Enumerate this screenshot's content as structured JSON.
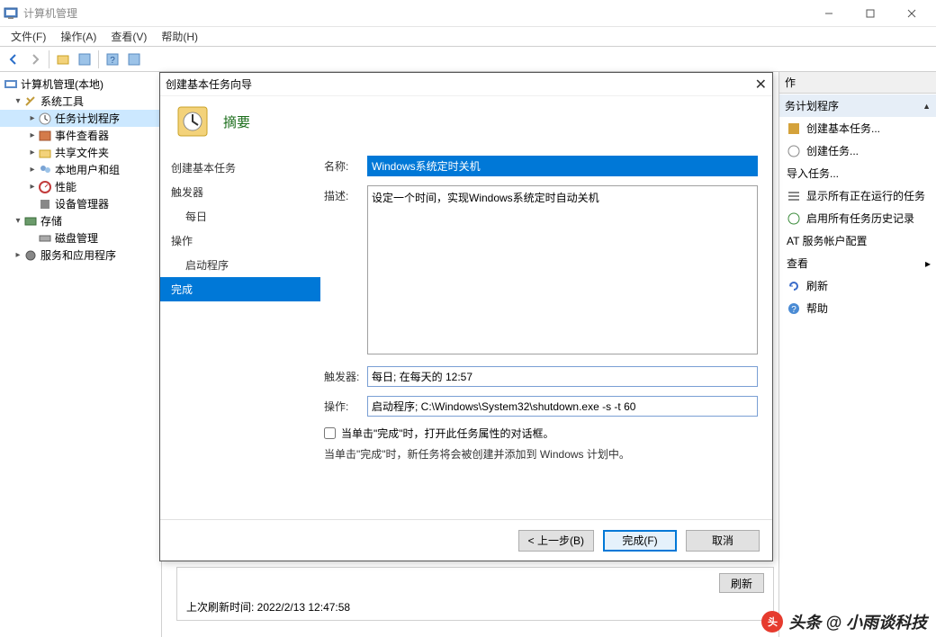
{
  "titlebar": {
    "title": "计算机管理"
  },
  "menu": {
    "file": "文件(F)",
    "action": "操作(A)",
    "view": "查看(V)",
    "help": "帮助(H)"
  },
  "tree": {
    "root": "计算机管理(本地)",
    "systools": "系统工具",
    "taskSched": "任务计划程序",
    "eventViewer": "事件查看器",
    "sharedFolders": "共享文件夹",
    "localUsers": "本地用户和组",
    "perf": "性能",
    "devmgr": "设备管理器",
    "storage": "存储",
    "diskmgr": "磁盘管理",
    "services": "服务和应用程序"
  },
  "rightPanel": {
    "header": "作",
    "groupTitle": "务计划程序",
    "actions": {
      "createBasic": "创建基本任务...",
      "createTask": "创建任务...",
      "importTask": "导入任务...",
      "showRunning": "显示所有正在运行的任务",
      "enableHistory": "启用所有任务历史记录",
      "atService": "AT 服务帐户配置",
      "view": "查看",
      "refresh": "刷新",
      "help": "帮助"
    }
  },
  "wizard": {
    "title": "创建基本任务向导",
    "headerTitle": "摘要",
    "nav": {
      "createBasic": "创建基本任务",
      "trigger": "触发器",
      "daily": "每日",
      "operation": "操作",
      "startProg": "启动程序",
      "finish": "完成"
    },
    "labels": {
      "name": "名称:",
      "desc": "描述:",
      "trigger": "触发器:",
      "action": "操作:"
    },
    "values": {
      "name": "Windows系统定时关机",
      "desc": "设定一个时间，实现Windows系统定时自动关机",
      "trigger": "每日; 在每天的 12:57",
      "action": "启动程序; C:\\Windows\\System32\\shutdown.exe -s -t 60"
    },
    "checkbox": "当单击\"完成\"时，打开此任务属性的对话框。",
    "note": "当单击\"完成\"时，新任务将会被创建并添加到 Windows 计划中。",
    "buttons": {
      "back": "< 上一步(B)",
      "finish": "完成(F)",
      "cancel": "取消"
    }
  },
  "bottom": {
    "lastRefresh": "上次刷新时间: 2022/2/13 12:47:58",
    "refresh": "刷新"
  },
  "watermark": "头条 @ 小雨谈科技"
}
